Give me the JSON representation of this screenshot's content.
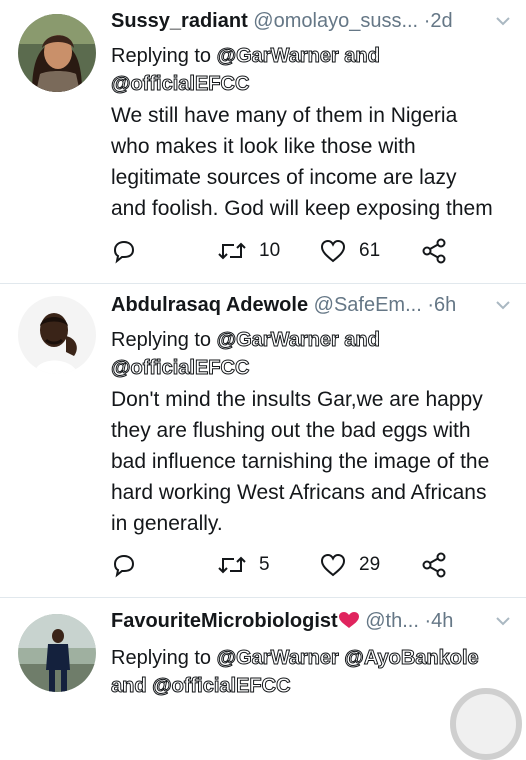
{
  "tweets": [
    {
      "name": "Sussy_radiant",
      "handle": "@omolayo_suss...",
      "separator": "·",
      "time": "2d",
      "replying_prefix": "Replying to",
      "mentions_line1": "@GarWarner and",
      "mentions_line2": "@officialEFCC",
      "text_lines": [
        "We still have many of them in Nigeria",
        "who makes it look like those with",
        "legitimate sources of income are lazy",
        "and foolish. God will keep exposing them"
      ],
      "retweets": "10",
      "likes": "61"
    },
    {
      "name": "Abdulrasaq Adewole",
      "handle": "@SafeEm...",
      "separator": "·",
      "time": "6h",
      "replying_prefix": "Replying to",
      "mentions_line1": "@GarWarner and",
      "mentions_line2": "@officialEFCC",
      "text_lines": [
        "Don't mind the insults Gar,we are happy",
        "they are flushing out the bad eggs with",
        "bad influence tarnishing the image of the",
        "hard working West Africans and Africans",
        "in generally."
      ],
      "retweets": "5",
      "likes": "29"
    },
    {
      "name": "FavouriteMicrobiologist",
      "handle": "@th...",
      "separator": "·",
      "time": "4h",
      "replying_prefix": "Replying to",
      "mentions_line1": "@GarWarner @AyoBankole",
      "mentions_line2": "and @officialEFCC"
    }
  ],
  "icons": {
    "reply": "reply-icon",
    "retweet": "retweet-icon",
    "like": "heart-icon",
    "share": "share-icon",
    "more": "chevron-down-icon",
    "heart_emoji": "pink-heart-emoji"
  },
  "colors": {
    "text": "#14171a",
    "secondary": "#657786",
    "divider": "#e1e8ed",
    "heart_emoji": "#e0245e"
  }
}
